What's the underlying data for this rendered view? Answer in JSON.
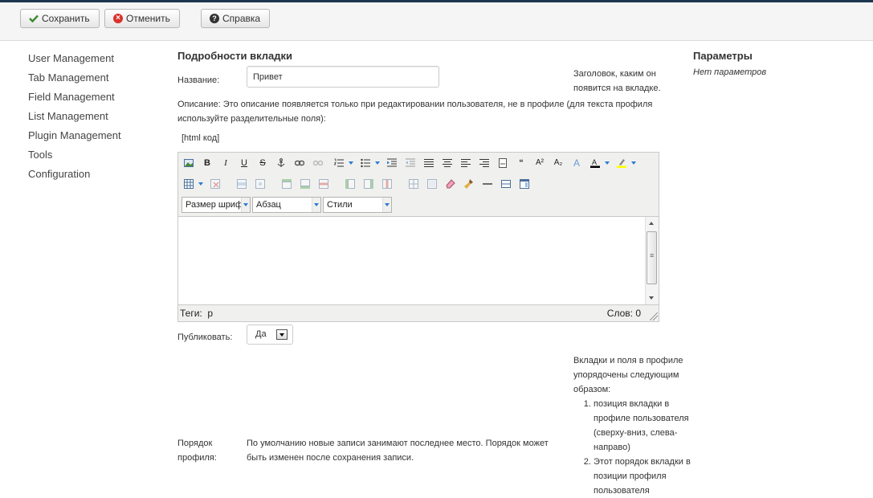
{
  "toolbar": {
    "save_label": "Сохранить",
    "cancel_label": "Отменить",
    "help_label": "Справка"
  },
  "sidebar": {
    "items": [
      {
        "label": "User Management"
      },
      {
        "label": "Tab Management"
      },
      {
        "label": "Field Management"
      },
      {
        "label": "List Management"
      },
      {
        "label": "Plugin Management"
      },
      {
        "label": "Tools"
      },
      {
        "label": "Configuration"
      }
    ]
  },
  "form": {
    "title": "Подробности вкладки",
    "name_label": "Название:",
    "name_value": "Привет",
    "name_hint": "Заголовок, каким он появится на вкладке.",
    "description_text": "Описание: Это описание появляется только при редактировании пользователя, не в профиле (для текста профиля используйте разделительные поля):",
    "html_code_label": "[html код]",
    "editor": {
      "font_size_placeholder": "Размер шрифта",
      "paragraph_format": "Абзац",
      "styles": "Стили",
      "tags_status": "Теги:  p",
      "word_count": "Слов: 0"
    },
    "publish_label": "Публиковать:",
    "publish_value": "Да",
    "order_label": "Порядок профиля:",
    "order_text": "По умолчанию новые записи занимают последнее место. Порядок может быть изменен после сохранения записи.",
    "order_hint_intro": "Вкладки и поля в профиле упорядочены следующим образом:",
    "order_hint_items": [
      "позиция вкладки в профиле пользователя (сверху-вниз, слева-направо)",
      "Этот порядок вкладки в позиции профиля пользователя"
    ]
  },
  "params": {
    "title": "Параметры",
    "none": "Нет параметров"
  },
  "colors": {
    "top_line": "#1c3650",
    "cancel_icon": "#d9332b",
    "check_icon": "#3c8a2e",
    "dropdown_arrow": "#2b7bd3"
  }
}
